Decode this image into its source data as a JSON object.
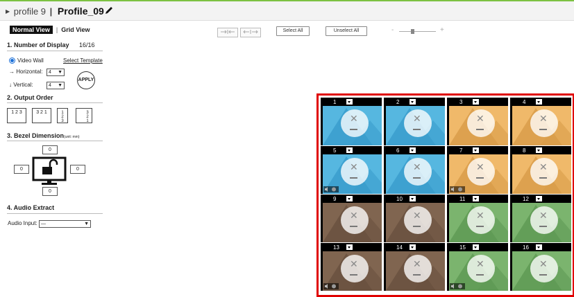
{
  "header": {
    "profile_label": "profile 9",
    "separator": "|",
    "profile_name": "Profile_09"
  },
  "view_tabs": {
    "normal": "Normal View",
    "separator": "|",
    "grid": "Grid View"
  },
  "sections": {
    "number_of_display": {
      "title": "1.  Number of Display",
      "count": "16/16",
      "mode_label": "Video Wall",
      "template_link": "Select Template",
      "horizontal_label": "Horizontal:",
      "horizontal_value": "4",
      "vertical_label": "Vertical:",
      "vertical_value": "4",
      "apply_label": "APPLY"
    },
    "output_order": {
      "title": "2.  Output Order",
      "options": [
        "1 2 3",
        "3 2 1"
      ],
      "vertical_options": [
        [
          "1",
          "2",
          "3"
        ],
        [
          "3",
          "2",
          "1"
        ]
      ]
    },
    "bezel": {
      "title": "3.  Bezel Dimension",
      "unit": "(unit: mm)",
      "top": "0",
      "left": "0",
      "right": "0",
      "bottom": "0"
    },
    "audio": {
      "title": "4.  Audio Extract",
      "input_label": "Audio Input:",
      "input_value": "—"
    }
  },
  "toolbar": {
    "select_all": "Select All",
    "unselect_all": "Unselect All",
    "zoom_minus": "-",
    "zoom_plus": "+",
    "zoom_level": 0.35
  },
  "wall": {
    "rows": 4,
    "cols": 4,
    "tiles": [
      {
        "n": "1",
        "color": "#56b7e0",
        "shade": "#3a9dcc"
      },
      {
        "n": "2",
        "color": "#56b7e0",
        "shade": "#3a9dcc"
      },
      {
        "n": "3",
        "color": "#f0b96a",
        "shade": "#d99c4a"
      },
      {
        "n": "4",
        "color": "#f0b96a",
        "shade": "#d99c4a"
      },
      {
        "n": "5",
        "color": "#56b7e0",
        "shade": "#3a9dcc",
        "audio": true
      },
      {
        "n": "6",
        "color": "#56b7e0",
        "shade": "#3a9dcc"
      },
      {
        "n": "7",
        "color": "#f0b96a",
        "shade": "#d99c4a",
        "audio": true
      },
      {
        "n": "8",
        "color": "#f0b96a",
        "shade": "#d99c4a"
      },
      {
        "n": "9",
        "color": "#806550",
        "shade": "#6a5140"
      },
      {
        "n": "10",
        "color": "#806550",
        "shade": "#6a5140"
      },
      {
        "n": "11",
        "color": "#7bb46e",
        "shade": "#5f9a55"
      },
      {
        "n": "12",
        "color": "#7bb46e",
        "shade": "#5f9a55"
      },
      {
        "n": "13",
        "color": "#806550",
        "shade": "#6a5140",
        "audio": true
      },
      {
        "n": "14",
        "color": "#806550",
        "shade": "#6a5140"
      },
      {
        "n": "15",
        "color": "#7bb46e",
        "shade": "#5f9a55",
        "audio": true
      },
      {
        "n": "16",
        "color": "#7bb46e",
        "shade": "#5f9a55"
      }
    ]
  },
  "colors": {
    "accent": "#7cc242",
    "selection": "#e00000"
  }
}
